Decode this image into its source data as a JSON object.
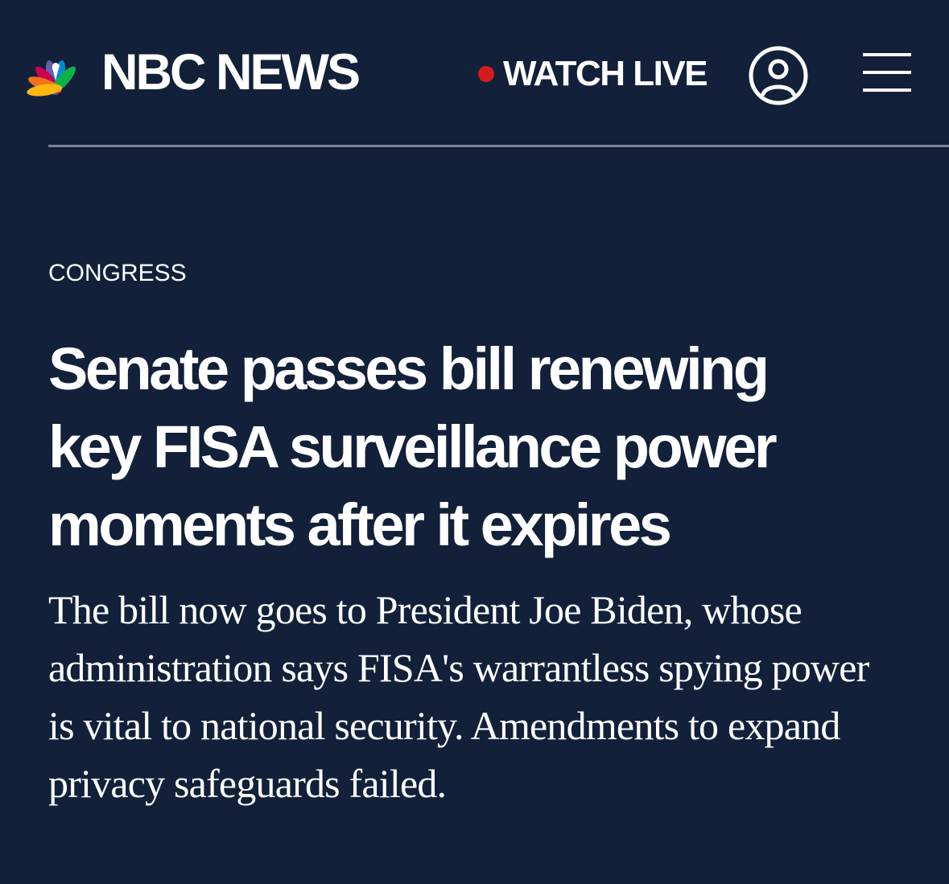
{
  "header": {
    "logo_text": "NBC NEWS",
    "logo_icon": "nbc-peacock-icon",
    "watch_live_label": "WATCH LIVE",
    "account_icon": "user-account-icon",
    "menu_icon": "hamburger-menu-icon"
  },
  "article": {
    "section": "CONGRESS",
    "headline_lines": [
      "Senate passes bill renewing",
      "key FISA surveillance power",
      "moments after it expires"
    ],
    "dek_lines": [
      "The bill now goes to President Joe Biden, whose",
      "administration says FISA's warrantless spying power",
      "is vital to national security. Amendments to expand",
      "privacy safeguards failed."
    ]
  },
  "colors": {
    "background": "#12203a",
    "text": "#ffffff",
    "live_dot": "#d51c1c",
    "divider": "#7c8596",
    "peacock": [
      "#fcb711",
      "#f37021",
      "#cc004c",
      "#6460aa",
      "#0089d0",
      "#0db14b"
    ]
  }
}
